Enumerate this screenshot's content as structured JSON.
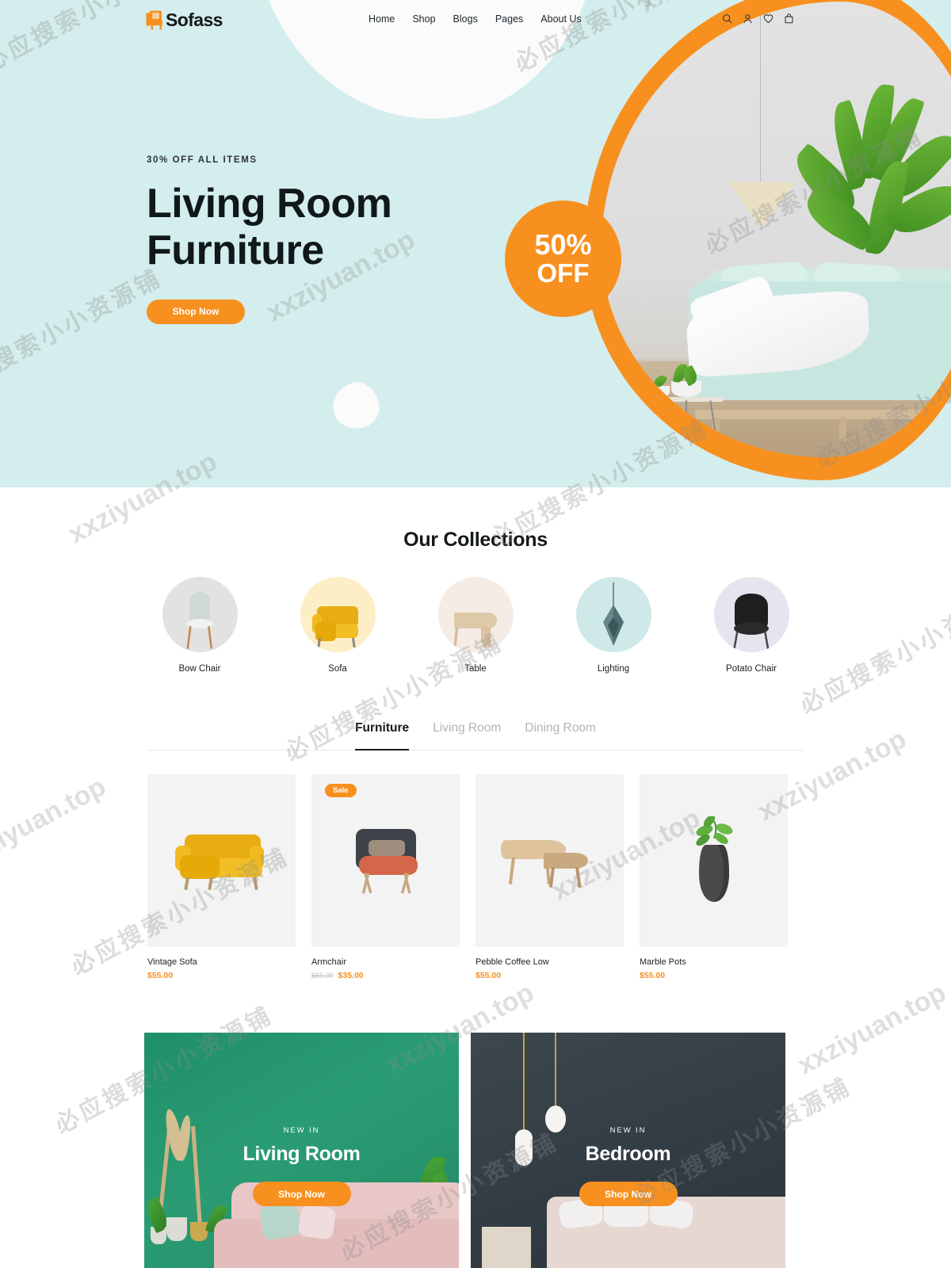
{
  "header": {
    "logo_text": "Sofass",
    "logo_icon": "armchair-icon",
    "nav": [
      {
        "label": "Home"
      },
      {
        "label": "Shop"
      },
      {
        "label": "Blogs"
      },
      {
        "label": "Pages"
      },
      {
        "label": "About Us"
      }
    ],
    "icons": [
      {
        "name": "search-icon"
      },
      {
        "name": "user-icon"
      },
      {
        "name": "heart-icon"
      },
      {
        "name": "bag-icon"
      }
    ]
  },
  "hero": {
    "eyebrow": "30% OFF ALL ITEMS",
    "title_line1": "Living Room",
    "title_line2": "Furniture",
    "cta": "Shop Now",
    "badge_line1": "50%",
    "badge_line2": "OFF",
    "bg_color": "#d4eded",
    "accent_color": "#f7901e"
  },
  "collections": {
    "title": "Our Collections",
    "items": [
      {
        "label": "Bow Chair",
        "circle_color": "#e2e3e1"
      },
      {
        "label": "Sofa",
        "circle_color": "#fdeec6"
      },
      {
        "label": "Table",
        "circle_color": "#f6ece6"
      },
      {
        "label": "Lighting",
        "circle_color": "#cfe9e8"
      },
      {
        "label": "Potato Chair",
        "circle_color": "#e7e4f0"
      }
    ]
  },
  "products": {
    "tabs": [
      {
        "label": "Furniture",
        "active": true
      },
      {
        "label": "Living Room",
        "active": false
      },
      {
        "label": "Dining Room",
        "active": false
      }
    ],
    "items": [
      {
        "name": "Vintage Sofa",
        "price": "$55.00",
        "old_price": "",
        "badge": ""
      },
      {
        "name": "Armchair",
        "price": "$35.00",
        "old_price": "$55.00",
        "badge": "Sale"
      },
      {
        "name": "Pebble Coffee Low",
        "price": "$55.00",
        "old_price": "",
        "badge": ""
      },
      {
        "name": "Marble Pots",
        "price": "$55.00",
        "old_price": "",
        "badge": ""
      }
    ],
    "price_color": "#f7901e"
  },
  "banners": [
    {
      "eyebrow": "NEW IN",
      "title": "Living Room",
      "cta": "Shop Now",
      "bg_color": "#2a9c74"
    },
    {
      "eyebrow": "NEW IN",
      "title": "Bedroom",
      "cta": "Shop Now",
      "bg_color": "#333d44"
    }
  ],
  "watermarks": {
    "cn": "必应搜索小小资源铺",
    "en": "xxziyuan.top"
  }
}
